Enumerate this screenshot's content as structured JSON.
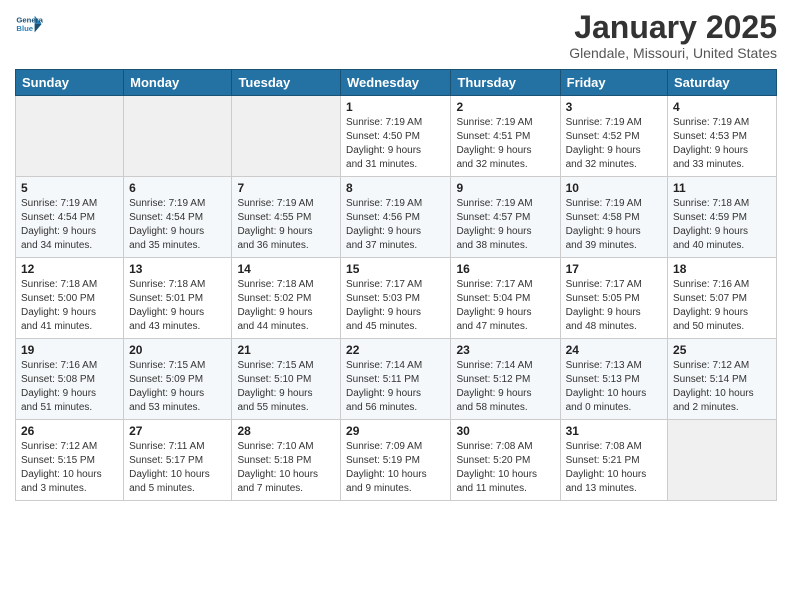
{
  "logo": {
    "text1": "General",
    "text2": "Blue"
  },
  "title": "January 2025",
  "location": "Glendale, Missouri, United States",
  "weekdays": [
    "Sunday",
    "Monday",
    "Tuesday",
    "Wednesday",
    "Thursday",
    "Friday",
    "Saturday"
  ],
  "weeks": [
    [
      {
        "day": "",
        "info": ""
      },
      {
        "day": "",
        "info": ""
      },
      {
        "day": "",
        "info": ""
      },
      {
        "day": "1",
        "info": "Sunrise: 7:19 AM\nSunset: 4:50 PM\nDaylight: 9 hours\nand 31 minutes."
      },
      {
        "day": "2",
        "info": "Sunrise: 7:19 AM\nSunset: 4:51 PM\nDaylight: 9 hours\nand 32 minutes."
      },
      {
        "day": "3",
        "info": "Sunrise: 7:19 AM\nSunset: 4:52 PM\nDaylight: 9 hours\nand 32 minutes."
      },
      {
        "day": "4",
        "info": "Sunrise: 7:19 AM\nSunset: 4:53 PM\nDaylight: 9 hours\nand 33 minutes."
      }
    ],
    [
      {
        "day": "5",
        "info": "Sunrise: 7:19 AM\nSunset: 4:54 PM\nDaylight: 9 hours\nand 34 minutes."
      },
      {
        "day": "6",
        "info": "Sunrise: 7:19 AM\nSunset: 4:54 PM\nDaylight: 9 hours\nand 35 minutes."
      },
      {
        "day": "7",
        "info": "Sunrise: 7:19 AM\nSunset: 4:55 PM\nDaylight: 9 hours\nand 36 minutes."
      },
      {
        "day": "8",
        "info": "Sunrise: 7:19 AM\nSunset: 4:56 PM\nDaylight: 9 hours\nand 37 minutes."
      },
      {
        "day": "9",
        "info": "Sunrise: 7:19 AM\nSunset: 4:57 PM\nDaylight: 9 hours\nand 38 minutes."
      },
      {
        "day": "10",
        "info": "Sunrise: 7:19 AM\nSunset: 4:58 PM\nDaylight: 9 hours\nand 39 minutes."
      },
      {
        "day": "11",
        "info": "Sunrise: 7:18 AM\nSunset: 4:59 PM\nDaylight: 9 hours\nand 40 minutes."
      }
    ],
    [
      {
        "day": "12",
        "info": "Sunrise: 7:18 AM\nSunset: 5:00 PM\nDaylight: 9 hours\nand 41 minutes."
      },
      {
        "day": "13",
        "info": "Sunrise: 7:18 AM\nSunset: 5:01 PM\nDaylight: 9 hours\nand 43 minutes."
      },
      {
        "day": "14",
        "info": "Sunrise: 7:18 AM\nSunset: 5:02 PM\nDaylight: 9 hours\nand 44 minutes."
      },
      {
        "day": "15",
        "info": "Sunrise: 7:17 AM\nSunset: 5:03 PM\nDaylight: 9 hours\nand 45 minutes."
      },
      {
        "day": "16",
        "info": "Sunrise: 7:17 AM\nSunset: 5:04 PM\nDaylight: 9 hours\nand 47 minutes."
      },
      {
        "day": "17",
        "info": "Sunrise: 7:17 AM\nSunset: 5:05 PM\nDaylight: 9 hours\nand 48 minutes."
      },
      {
        "day": "18",
        "info": "Sunrise: 7:16 AM\nSunset: 5:07 PM\nDaylight: 9 hours\nand 50 minutes."
      }
    ],
    [
      {
        "day": "19",
        "info": "Sunrise: 7:16 AM\nSunset: 5:08 PM\nDaylight: 9 hours\nand 51 minutes."
      },
      {
        "day": "20",
        "info": "Sunrise: 7:15 AM\nSunset: 5:09 PM\nDaylight: 9 hours\nand 53 minutes."
      },
      {
        "day": "21",
        "info": "Sunrise: 7:15 AM\nSunset: 5:10 PM\nDaylight: 9 hours\nand 55 minutes."
      },
      {
        "day": "22",
        "info": "Sunrise: 7:14 AM\nSunset: 5:11 PM\nDaylight: 9 hours\nand 56 minutes."
      },
      {
        "day": "23",
        "info": "Sunrise: 7:14 AM\nSunset: 5:12 PM\nDaylight: 9 hours\nand 58 minutes."
      },
      {
        "day": "24",
        "info": "Sunrise: 7:13 AM\nSunset: 5:13 PM\nDaylight: 10 hours\nand 0 minutes."
      },
      {
        "day": "25",
        "info": "Sunrise: 7:12 AM\nSunset: 5:14 PM\nDaylight: 10 hours\nand 2 minutes."
      }
    ],
    [
      {
        "day": "26",
        "info": "Sunrise: 7:12 AM\nSunset: 5:15 PM\nDaylight: 10 hours\nand 3 minutes."
      },
      {
        "day": "27",
        "info": "Sunrise: 7:11 AM\nSunset: 5:17 PM\nDaylight: 10 hours\nand 5 minutes."
      },
      {
        "day": "28",
        "info": "Sunrise: 7:10 AM\nSunset: 5:18 PM\nDaylight: 10 hours\nand 7 minutes."
      },
      {
        "day": "29",
        "info": "Sunrise: 7:09 AM\nSunset: 5:19 PM\nDaylight: 10 hours\nand 9 minutes."
      },
      {
        "day": "30",
        "info": "Sunrise: 7:08 AM\nSunset: 5:20 PM\nDaylight: 10 hours\nand 11 minutes."
      },
      {
        "day": "31",
        "info": "Sunrise: 7:08 AM\nSunset: 5:21 PM\nDaylight: 10 hours\nand 13 minutes."
      },
      {
        "day": "",
        "info": ""
      }
    ]
  ]
}
